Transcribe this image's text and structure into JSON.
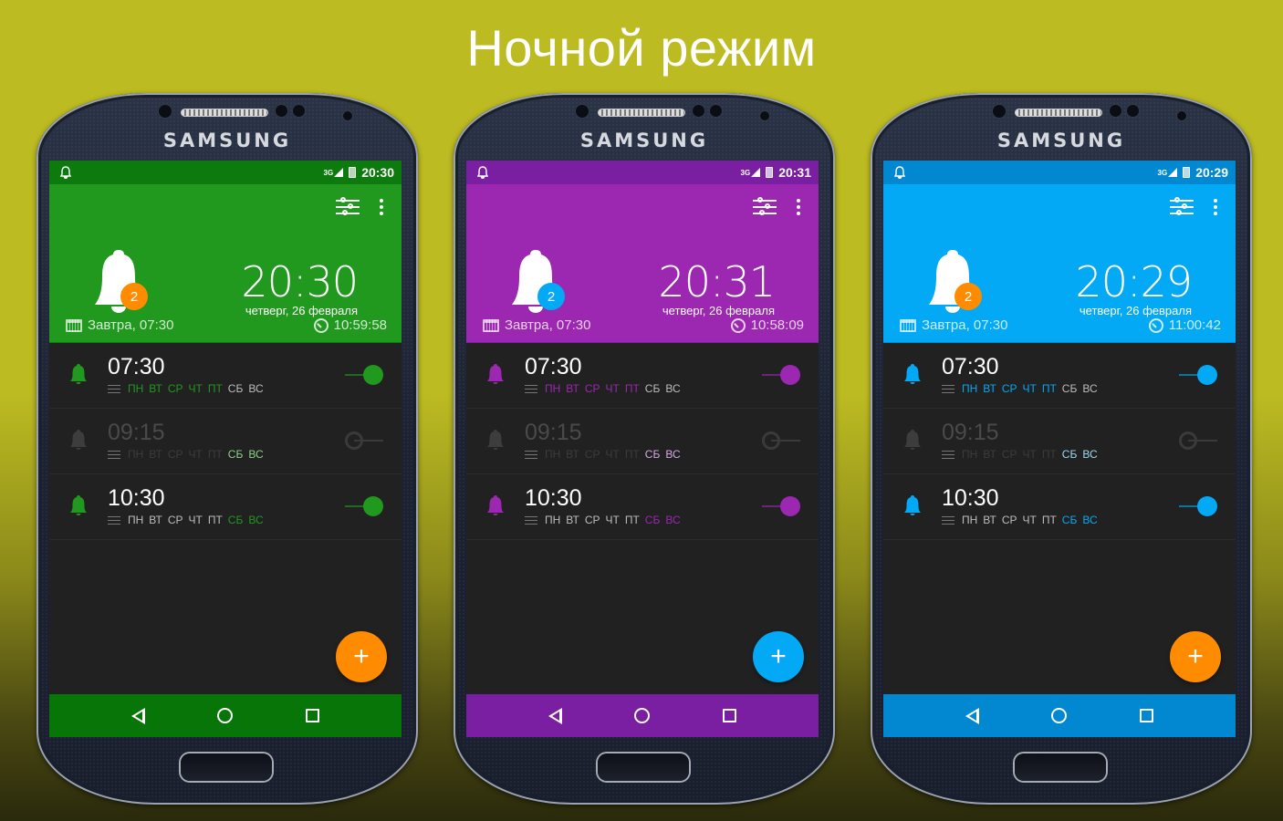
{
  "headline": "Ночной режим",
  "brand": "SAMSUNG",
  "phones": [
    {
      "theme": {
        "status": "#0c7a0c",
        "header": "#21991f",
        "nav": "#087508",
        "accent": "#21991f",
        "accent_dim": "#8ed18c",
        "badge": "#ff8c00",
        "fab": "#ff8c00"
      },
      "status_time": "20:30",
      "network": "3G",
      "clock_time": "20:30",
      "date": "четверг, 26 февраля",
      "badge_count": "2",
      "next_alarm": "Завтра, 07:30",
      "countdown": "10:59:58",
      "fab_label": "+",
      "alarms": [
        {
          "time": "07:30",
          "enabled": true,
          "days": [
            "ПН",
            "ВТ",
            "СР",
            "ЧТ",
            "ПТ",
            "СБ",
            "ВС"
          ],
          "active_days": [
            0,
            1,
            2,
            3,
            4
          ]
        },
        {
          "time": "09:15",
          "enabled": false,
          "days": [
            "ПН",
            "ВТ",
            "СР",
            "ЧТ",
            "ПТ",
            "СБ",
            "ВС"
          ],
          "active_days": [
            5,
            6
          ]
        },
        {
          "time": "10:30",
          "enabled": true,
          "days": [
            "ПН",
            "ВТ",
            "СР",
            "ЧТ",
            "ПТ",
            "СБ",
            "ВС"
          ],
          "active_days": [
            5,
            6
          ]
        }
      ]
    },
    {
      "theme": {
        "status": "#7b1fa2",
        "header": "#9c27b0",
        "nav": "#7b1fa2",
        "accent": "#9c27b0",
        "accent_dim": "#d7a8e3",
        "badge": "#03a9f4",
        "fab": "#03a9f4"
      },
      "status_time": "20:31",
      "network": "3G",
      "clock_time": "20:31",
      "date": "четверг, 26 февраля",
      "badge_count": "2",
      "next_alarm": "Завтра, 07:30",
      "countdown": "10:58:09",
      "fab_label": "+",
      "alarms": [
        {
          "time": "07:30",
          "enabled": true,
          "days": [
            "ПН",
            "ВТ",
            "СР",
            "ЧТ",
            "ПТ",
            "СБ",
            "ВС"
          ],
          "active_days": [
            0,
            1,
            2,
            3,
            4
          ]
        },
        {
          "time": "09:15",
          "enabled": false,
          "days": [
            "ПН",
            "ВТ",
            "СР",
            "ЧТ",
            "ПТ",
            "СБ",
            "ВС"
          ],
          "active_days": [
            5,
            6
          ]
        },
        {
          "time": "10:30",
          "enabled": true,
          "days": [
            "ПН",
            "ВТ",
            "СР",
            "ЧТ",
            "ПТ",
            "СБ",
            "ВС"
          ],
          "active_days": [
            5,
            6
          ]
        }
      ]
    },
    {
      "theme": {
        "status": "#0288d1",
        "header": "#03a9f4",
        "nav": "#0288d1",
        "accent": "#03a9f4",
        "accent_dim": "#9fd8f6",
        "badge": "#ff8c00",
        "fab": "#ff8c00"
      },
      "status_time": "20:29",
      "network": "3G",
      "clock_time": "20:29",
      "date": "четверг, 26 февраля",
      "badge_count": "2",
      "next_alarm": "Завтра, 07:30",
      "countdown": "11:00:42",
      "fab_label": "+",
      "alarms": [
        {
          "time": "07:30",
          "enabled": true,
          "days": [
            "ПН",
            "ВТ",
            "СР",
            "ЧТ",
            "ПТ",
            "СБ",
            "ВС"
          ],
          "active_days": [
            0,
            1,
            2,
            3,
            4
          ]
        },
        {
          "time": "09:15",
          "enabled": false,
          "days": [
            "ПН",
            "ВТ",
            "СР",
            "ЧТ",
            "ПТ",
            "СБ",
            "ВС"
          ],
          "active_days": [
            5,
            6
          ]
        },
        {
          "time": "10:30",
          "enabled": true,
          "days": [
            "ПН",
            "ВТ",
            "СР",
            "ЧТ",
            "ПТ",
            "СБ",
            "ВС"
          ],
          "active_days": [
            5,
            6
          ]
        }
      ]
    }
  ]
}
